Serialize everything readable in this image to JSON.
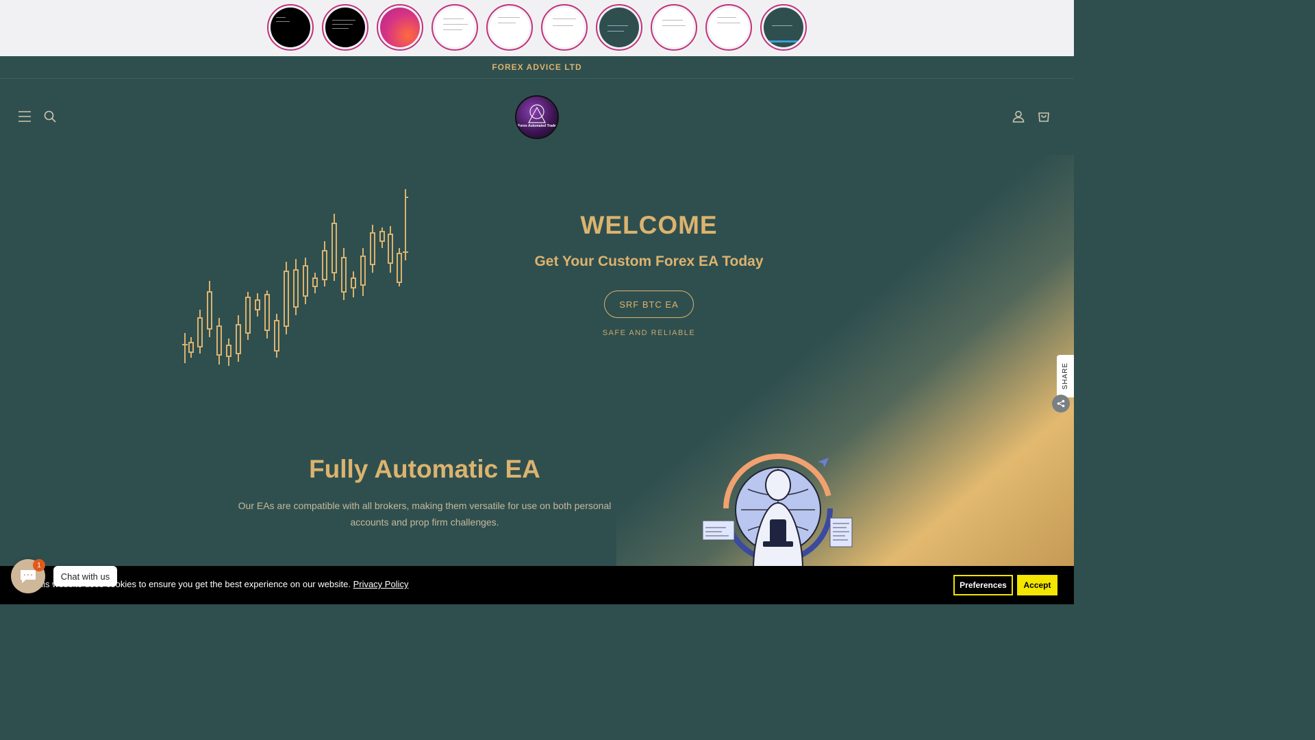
{
  "stories": [
    {
      "theme": "black"
    },
    {
      "theme": "black"
    },
    {
      "theme": "gradient"
    },
    {
      "theme": "white"
    },
    {
      "theme": "white"
    },
    {
      "theme": "white"
    },
    {
      "theme": "teal"
    },
    {
      "theme": "white"
    },
    {
      "theme": "white"
    },
    {
      "theme": "teal"
    }
  ],
  "announcement": "FOREX ADVICE LTD",
  "header": {
    "menu_icon": "hamburger-icon",
    "search_icon": "search-icon",
    "logo_text": "Forex Automated Trade",
    "account_icon": "account-icon",
    "cart_icon": "cart-icon"
  },
  "hero": {
    "title": "WELCOME",
    "subtitle": "Get Your Custom Forex EA Today",
    "cta_label": "SRF BTC EA",
    "tagline": "SAFE AND RELIABLE"
  },
  "section": {
    "title": "Fully Automatic EA",
    "text": "Our EAs are compatible with all brokers, making them versatile for use on both personal accounts and prop firm challenges."
  },
  "share": {
    "label": "SHARE",
    "icon": "share-icon"
  },
  "cookie": {
    "text": "This website uses cookies to ensure you get the best experience on our website.",
    "link": "Privacy Policy",
    "preferences": "Preferences",
    "accept": "Accept"
  },
  "chat": {
    "label": "Chat with us",
    "badge": "1",
    "icon": "chat-icon"
  },
  "colors": {
    "accent": "#dcb36e",
    "background": "#2f4f4f",
    "cookie_accent": "#f3e600"
  }
}
